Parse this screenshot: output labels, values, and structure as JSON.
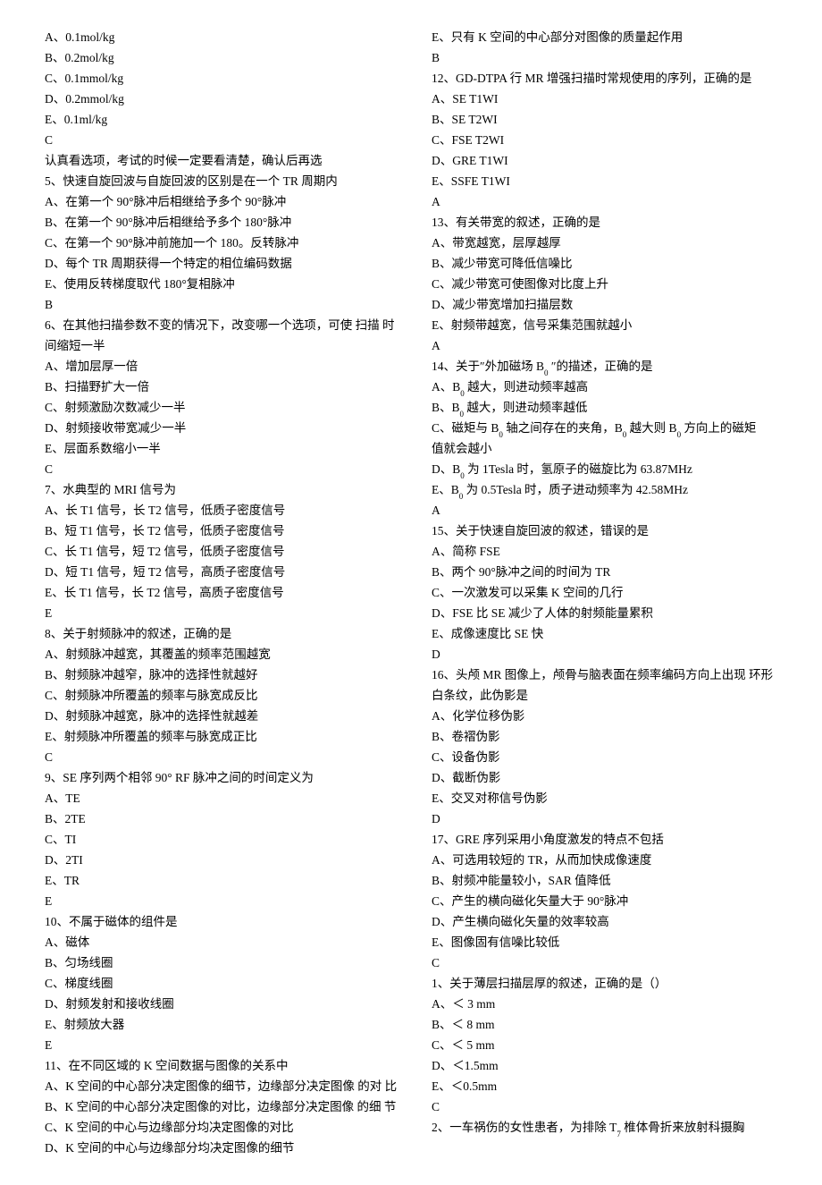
{
  "left": [
    {
      "t": "A、0.1mol/kg"
    },
    {
      "t": "B、0.2mol/kg"
    },
    {
      "t": "C、0.1mmol/kg"
    },
    {
      "t": "D、0.2mmol/kg"
    },
    {
      "t": "E、0.1ml/kg"
    },
    {
      "t": "C"
    },
    {
      "t": "认真看选项，考试的时候一定要看清楚，确认后再选"
    },
    {
      "t": "5、快速自旋回波与自旋回波的区别是在一个 TR 周期内"
    },
    {
      "t": "A、在第一个 90°脉冲后相继给予多个 90°脉冲"
    },
    {
      "t": "B、在第一个 90°脉冲后相继给予多个 180°脉冲"
    },
    {
      "t": "C、在第一个 90°脉冲前施加一个 180。反转脉冲"
    },
    {
      "t": "D、每个 TR 周期获得一个特定的相位编码数据"
    },
    {
      "t": "E、使用反转梯度取代 180°复相脉冲"
    },
    {
      "t": "B"
    },
    {
      "t": "6、在其他扫描参数不变的情况下，改变哪一个选项，可使 扫描 时间缩短一半"
    },
    {
      "t": "A、增加层厚一倍"
    },
    {
      "t": "B、扫描野扩大一倍"
    },
    {
      "t": "C、射频激励次数减少一半"
    },
    {
      "t": "D、射频接收带宽减少一半"
    },
    {
      "t": "E、层面系数缩小一半"
    },
    {
      "t": "C"
    },
    {
      "t": "7、水典型的 MRI 信号为"
    },
    {
      "t": "A、长 T1 信号，长 T2 信号，低质子密度信号"
    },
    {
      "t": "B、短 T1 信号，长 T2 信号，低质子密度信号"
    },
    {
      "t": "C、长 T1 信号，短 T2 信号，低质子密度信号"
    },
    {
      "t": "D、短 T1 信号，短 T2 信号，高质子密度信号"
    },
    {
      "t": "E、长 T1 信号，长 T2 信号，高质子密度信号"
    },
    {
      "t": "E"
    },
    {
      "t": "8、关于射频脉冲的叙述，正确的是"
    },
    {
      "t": "A、射频脉冲越宽，其覆盖的频率范围越宽"
    },
    {
      "t": "B、射频脉冲越窄，脉冲的选择性就越好"
    },
    {
      "t": "C、射频脉冲所覆盖的频率与脉宽成反比"
    },
    {
      "t": "D、射频脉冲越宽，脉冲的选择性就越差"
    },
    {
      "t": "E、射频脉冲所覆盖的频率与脉宽成正比"
    },
    {
      "t": "C"
    },
    {
      "t": "9、SE 序列两个相邻 90° RF 脉冲之间的时间定义为"
    },
    {
      "t": "A、TE"
    },
    {
      "t": "B、2TE"
    },
    {
      "t": "C、TI"
    },
    {
      "t": "D、2TI"
    },
    {
      "t": "E、TR"
    },
    {
      "t": "E"
    },
    {
      "t": "10、不属于磁体的组件是"
    },
    {
      "t": "A、磁体"
    },
    {
      "t": "B、匀场线圈"
    },
    {
      "t": "C、梯度线圈"
    },
    {
      "t": "D、射频发射和接收线圈"
    },
    {
      "t": "E、射频放大器"
    },
    {
      "t": "E"
    },
    {
      "t": "11、在不同区域的 K 空间数据与图像的关系中"
    },
    {
      "t": "A、K 空间的中心部分决定图像的细节，边缘部分决定图像 的对 比"
    },
    {
      "t": "B、K 空间的中心部分决定图像的对比，边缘部分决定图像 的细 节"
    },
    {
      "t": "C、K 空间的中心与边缘部分均决定图像的对比"
    },
    {
      "t": "D、K 空间的中心与边缘部分均决定图像的细节"
    }
  ],
  "right": [
    {
      "t": "E、只有 K 空间的中心部分对图像的质量起作用"
    },
    {
      "t": "B"
    },
    {
      "t": "12、GD-DTPA 行 MR 增强扫描时常规使用的序列，正确的是"
    },
    {
      "t": "A、SE T1WI"
    },
    {
      "t": "B、SE T2WI"
    },
    {
      "t": "C、FSE T2WI"
    },
    {
      "t": "D、GRE T1WI"
    },
    {
      "t": "E、SSFE T1WI"
    },
    {
      "t": "A"
    },
    {
      "t": "13、有关带宽的叙述，正确的是"
    },
    {
      "t": "A、带宽越宽，层厚越厚"
    },
    {
      "t": "B、减少带宽可降低信噪比"
    },
    {
      "t": "C、减少带宽可使图像对比度上升"
    },
    {
      "t": "D、减少带宽增加扫描层数"
    },
    {
      "t": "E、射频带越宽，信号采集范围就越小"
    },
    {
      "t": "A"
    },
    {
      "t": "14、关于″外加磁场 B ″的描述，正确的是",
      "sub_after_B": true
    },
    {
      "t": "A、B 越大，则进动频率越高",
      "sub_after_B": true
    },
    {
      "t": "B、B 越大，则进动频率越低",
      "sub_after_B": true
    },
    {
      "t": "C、磁矩与 B 轴之间存在的夹角，B 越大则 B 方向上的磁矩",
      "sub_after_B_multi": true
    },
    {
      "t": "值就会越小"
    },
    {
      "t": "D、B 为 1Tesla 时，氢原子的磁旋比为 63.87MHz",
      "sub_after_B": true
    },
    {
      "t": "E、B 为 0.5Tesla 时，质子进动频率为 42.58MHz",
      "sub_after_B": true
    },
    {
      "t": "A"
    },
    {
      "t": "15、关于快速自旋回波的叙述，错误的是"
    },
    {
      "t": "A、简称 FSE"
    },
    {
      "t": "B、两个 90°脉冲之间的时间为 TR"
    },
    {
      "t": "C、一次激发可以采集 K 空间的几行"
    },
    {
      "t": "D、FSE 比 SE 减少了人体的射频能量累积"
    },
    {
      "t": "E、成像速度比 SE 快"
    },
    {
      "t": "D"
    },
    {
      "t": "16、头颅 MR 图像上，颅骨与脑表面在频率编码方向上出现 环形 白条纹，此伪影是"
    },
    {
      "t": "A、化学位移伪影"
    },
    {
      "t": "B、卷褶伪影"
    },
    {
      "t": "C、设备伪影"
    },
    {
      "t": "D、截断伪影"
    },
    {
      "t": "E、交叉对称信号伪影"
    },
    {
      "t": "D"
    },
    {
      "t": "17、GRE 序列采用小角度激发的特点不包括"
    },
    {
      "t": "A、可选用较短的 TR，从而加快成像速度"
    },
    {
      "t": "B、射频冲能量较小，SAR 值降低"
    },
    {
      "t": "C、产生的横向磁化矢量大于 90°脉冲"
    },
    {
      "t": "D、产生横向磁化矢量的效率较高"
    },
    {
      "t": "E、图像固有信噪比较低"
    },
    {
      "t": "C"
    },
    {
      "t": "1、关于薄层扫描层厚的叙述，正确的是（）"
    },
    {
      "t": "A、＜ 3 mm"
    },
    {
      "t": "B、＜ 8 mm"
    },
    {
      "t": "C、＜ 5 mm"
    },
    {
      "t": "D、＜1.5mm"
    },
    {
      "t": "E、＜0.5mm"
    },
    {
      "t": "C"
    },
    {
      "t": "2、一车祸伤的女性患者，为排除 T 椎体骨折来放射科摄胸",
      "sub_T7": true
    }
  ]
}
